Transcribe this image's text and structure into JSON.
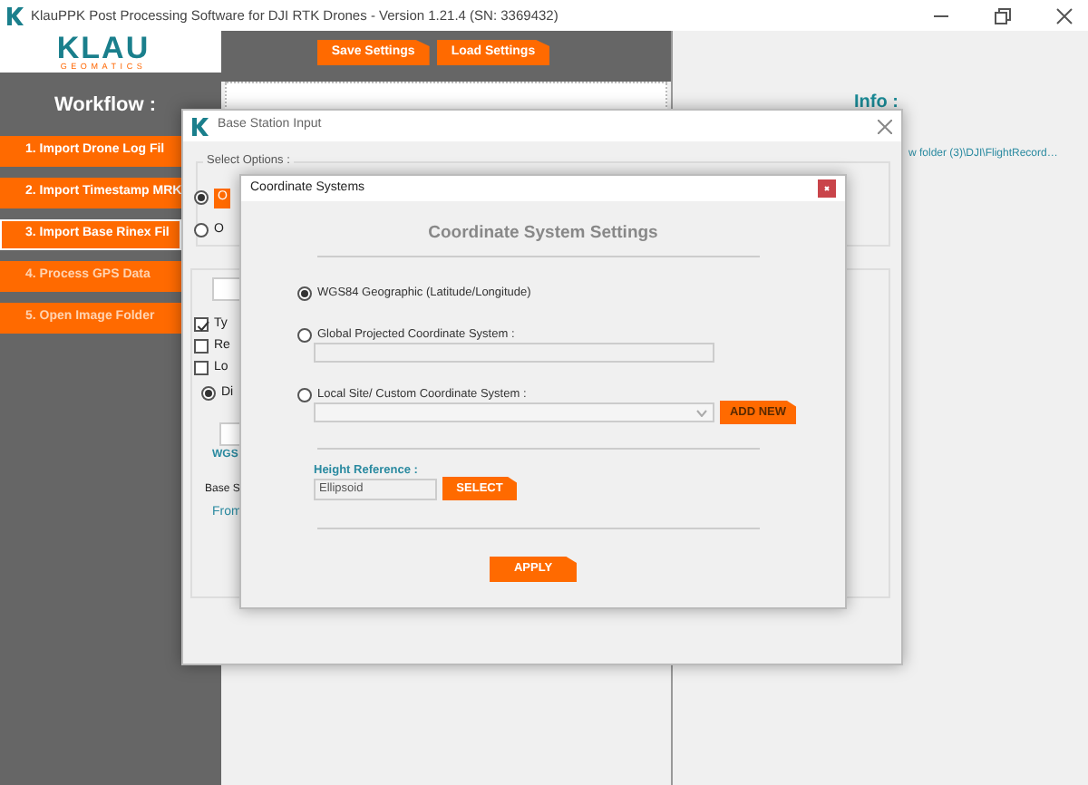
{
  "window": {
    "title": "KlauPPK Post Processing Software for DJI RTK Drones - Version 1.21.4 (SN: 3369432)"
  },
  "logo": {
    "name": "KLAU",
    "subtitle": "GEOMATICS"
  },
  "toolbar": {
    "buttons": [
      "Save Settings",
      "Load Settings"
    ]
  },
  "workflow": {
    "title": "Workflow :",
    "steps": [
      {
        "label": "1. Import Drone Log Fil",
        "selected": false
      },
      {
        "label": "2. Import Timestamp MRK",
        "selected": false
      },
      {
        "label": "3. Import Base Rinex Fil",
        "selected": true
      },
      {
        "label": "4. Process GPS Data",
        "selected": false
      },
      {
        "label": "5. Open Image Folder",
        "selected": false
      }
    ]
  },
  "info": {
    "title": "Info :",
    "path": "w folder (3)\\DJI\\FlightRecord…"
  },
  "base_station_dialog": {
    "title": "Base Station Input",
    "select_options": {
      "label": "Select Options :",
      "options": [
        {
          "label": "O",
          "selected": true
        },
        {
          "label": "O",
          "selected": false
        }
      ]
    },
    "settings": {
      "checkboxes": [
        {
          "label": "Ty",
          "checked": true
        },
        {
          "label": "Re",
          "checked": false
        },
        {
          "label": "Lo",
          "checked": false
        }
      ],
      "radio": {
        "label": "Di",
        "selected": true
      },
      "coordinate_link": "WGS",
      "base_label": "Base S",
      "from_link": "From"
    }
  },
  "coordinate_dialog": {
    "title": "Coordinate Systems",
    "heading": "Coordinate System Settings",
    "options": [
      {
        "kind": "plain",
        "label": "WGS84 Geographic  (Latitude/Longitude)",
        "selected": true
      },
      {
        "kind": "field",
        "label": "Global Projected Coordinate System :",
        "selected": false
      },
      {
        "kind": "combo",
        "label": "Local Site/ Custom Coordinate System :",
        "selected": false,
        "button": "ADD NEW"
      }
    ],
    "height_reference": {
      "label": "Height Reference :",
      "value": "Ellipsoid",
      "button": "SELECT"
    },
    "apply": "APPLY"
  }
}
